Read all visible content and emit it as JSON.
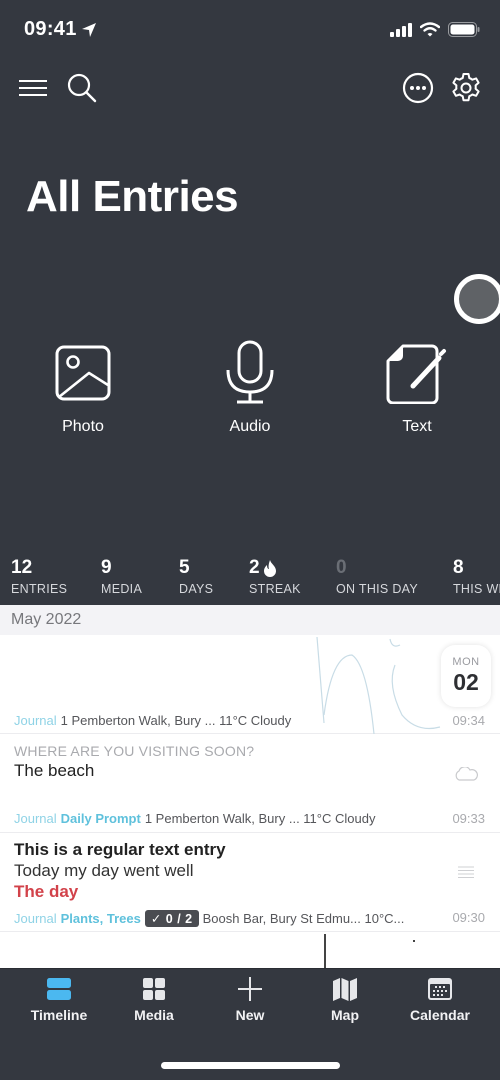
{
  "status_bar": {
    "time": "09:41",
    "icons": [
      "location-arrow-icon",
      "cellular-signal-icon",
      "wifi-icon",
      "battery-icon"
    ]
  },
  "toolbar": {
    "left_icons": [
      "menu-icon",
      "search-icon"
    ],
    "right_icons": [
      "more-icon",
      "gear-icon"
    ]
  },
  "header": {
    "title": "All Entries"
  },
  "quick_actions": [
    {
      "label": "Photo",
      "icon": "photo-icon"
    },
    {
      "label": "Audio",
      "icon": "microphone-icon"
    },
    {
      "label": "Text",
      "icon": "text-document-icon"
    }
  ],
  "stats": [
    {
      "value": "12",
      "label": "ENTRIES"
    },
    {
      "value": "9",
      "label": "MEDIA"
    },
    {
      "value": "5",
      "label": "DAYS"
    },
    {
      "value": "2",
      "label": "STREAK",
      "icon": "flame-icon"
    },
    {
      "value": "0",
      "label": "ON THIS DAY"
    },
    {
      "value": "8",
      "label": "THIS WEEK"
    }
  ],
  "timeline": {
    "month": "May 2022",
    "date_badge": {
      "weekday": "MON",
      "day": "02"
    },
    "entries": [
      {
        "type": "drawing",
        "journal": "Journal",
        "tags": "",
        "meta": "1 Pemberton Walk, Bury ... 11°C Cloudy",
        "time": "09:34"
      },
      {
        "type": "prompt",
        "prompt": "WHERE ARE YOU VISITING SOON?",
        "answer": "The beach",
        "journal": "Journal",
        "tags": "Daily Prompt",
        "meta": "1 Pemberton Walk, Bury ... 11°C Cloudy",
        "time": "09:33",
        "icon": "cloud-icon"
      },
      {
        "type": "text",
        "title": "This is a regular text entry",
        "line": "Today my day went well",
        "highlight": "The day",
        "journal": "Journal",
        "tags": "Plants, Trees",
        "checklist": "✓ 0 / 2",
        "meta": "Boosh Bar, Bury St Edmu... 10°C...",
        "time": "09:30",
        "icon": "text-lines-icon"
      }
    ]
  },
  "tabbar": {
    "active": "Timeline",
    "active_color": "#4bb8f0",
    "tabs": [
      {
        "label": "Timeline",
        "icon": "timeline-icon"
      },
      {
        "label": "Media",
        "icon": "grid-icon"
      },
      {
        "label": "New",
        "icon": "plus-icon"
      },
      {
        "label": "Map",
        "icon": "map-icon"
      },
      {
        "label": "Calendar",
        "icon": "calendar-icon"
      }
    ]
  }
}
